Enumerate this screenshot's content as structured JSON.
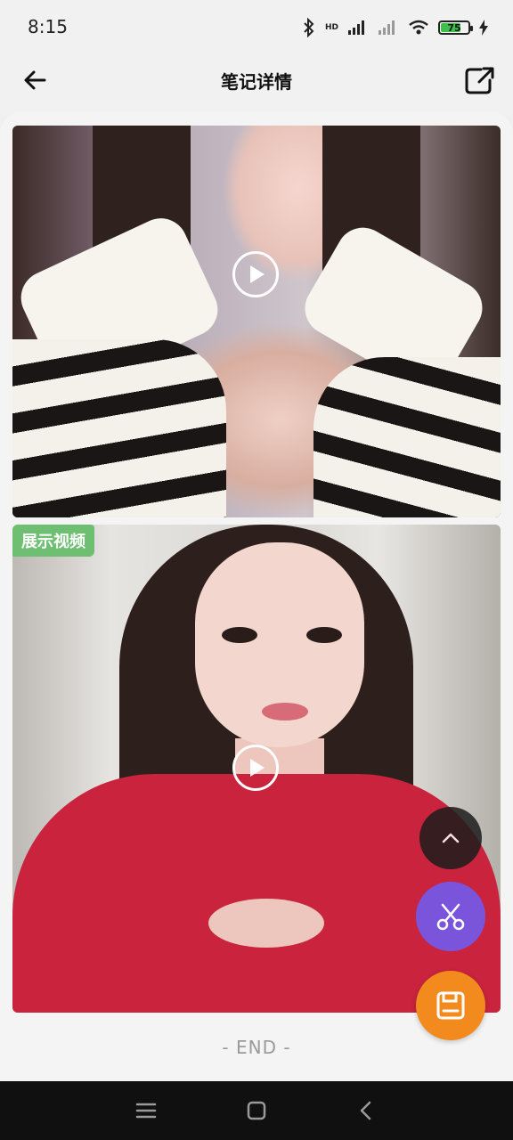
{
  "status_bar": {
    "time": "8:15",
    "network": "HD",
    "battery": "75"
  },
  "header": {
    "title": "笔记详情"
  },
  "media": [
    {
      "type": "video"
    },
    {
      "type": "video",
      "badge": "展示视频"
    }
  ],
  "footer": {
    "end_text": "- END -"
  },
  "colors": {
    "badge": "#6fbf72",
    "fab_cut": "#7a55dc",
    "fab_save": "#f28a1e",
    "battery": "#3cc24b"
  },
  "icons": [
    "back-arrow-icon",
    "share-icon",
    "play-icon",
    "chevron-up-icon",
    "scissors-icon",
    "save-icon",
    "menu-icon",
    "home-icon",
    "back-nav-icon",
    "bluetooth-icon",
    "signal-icon",
    "wifi-icon",
    "charging-icon"
  ]
}
